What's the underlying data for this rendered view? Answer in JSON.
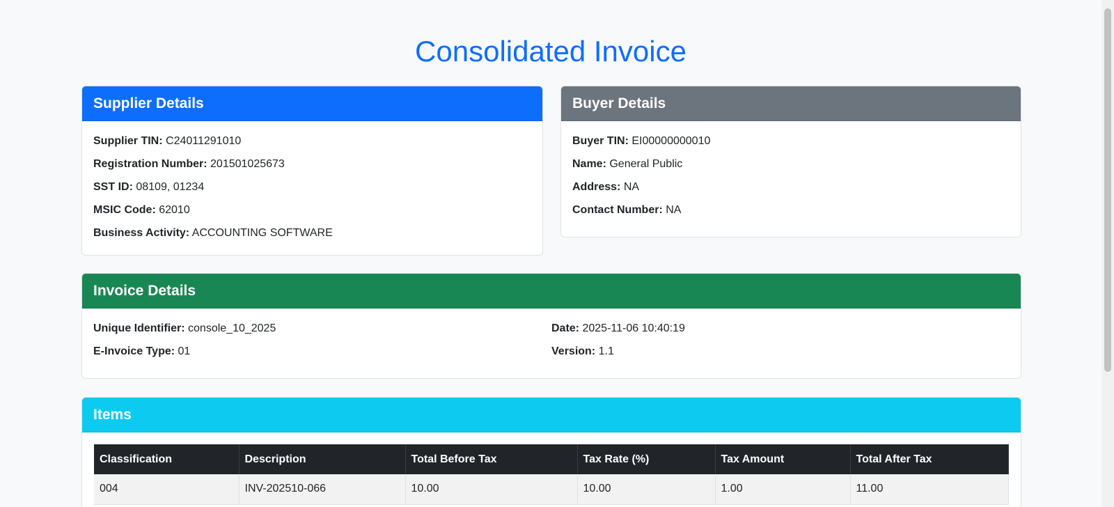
{
  "page_title": "Consolidated Invoice",
  "supplier": {
    "header": "Supplier Details",
    "fields": [
      {
        "label": "Supplier TIN:",
        "value": "C24011291010"
      },
      {
        "label": "Registration Number:",
        "value": "201501025673"
      },
      {
        "label": "SST ID:",
        "value": "08109, 01234"
      },
      {
        "label": "MSIC Code:",
        "value": "62010"
      },
      {
        "label": "Business Activity:",
        "value": "ACCOUNTING SOFTWARE"
      }
    ]
  },
  "buyer": {
    "header": "Buyer Details",
    "fields": [
      {
        "label": "Buyer TIN:",
        "value": "EI00000000010"
      },
      {
        "label": "Name:",
        "value": "General Public"
      },
      {
        "label": "Address:",
        "value": "NA"
      },
      {
        "label": "Contact Number:",
        "value": "NA"
      }
    ]
  },
  "invoice": {
    "header": "Invoice Details",
    "fields": [
      {
        "label": "Unique Identifier:",
        "value": "console_10_2025"
      },
      {
        "label": "Date:",
        "value": "2025-11-06 10:40:19"
      },
      {
        "label": "E-Invoice Type:",
        "value": "01"
      },
      {
        "label": "Version:",
        "value": "1.1"
      }
    ]
  },
  "items": {
    "header": "Items",
    "columns": [
      "Classification",
      "Description",
      "Total Before Tax",
      "Tax Rate (%)",
      "Tax Amount",
      "Total After Tax"
    ],
    "rows": [
      [
        "004",
        "INV-202510-066",
        "10.00",
        "10.00",
        "1.00",
        "11.00"
      ]
    ]
  },
  "colors": {
    "title": "#0d6efd",
    "supplier_header": "#0d6efd",
    "buyer_header": "#6c757d",
    "invoice_header": "#198754",
    "items_header": "#0dcaf0",
    "table_header": "#212529"
  }
}
